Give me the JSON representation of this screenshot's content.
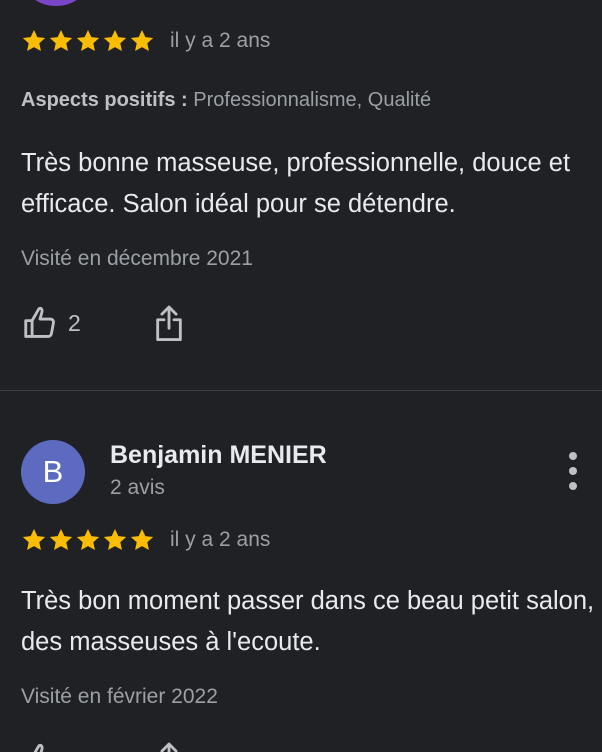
{
  "colors": {
    "background": "#202124",
    "star": "#fbbc04",
    "avatar_top": "#7b45c8",
    "avatar": "#5c6bc0"
  },
  "reviews": [
    {
      "rating": 5,
      "time_ago": "il y a 2 ans",
      "aspects_label": "Aspects positifs :",
      "aspects_value": "Professionnalisme, Qualité",
      "text": "Très bonne masseuse, professionnelle, douce et efficace. Salon idéal pour se détendre.",
      "visited": "Visité en décembre 2021",
      "like_count": "2",
      "icons": {
        "like": "thumbs-up-icon",
        "share": "share-icon"
      }
    },
    {
      "author": {
        "initial": "B",
        "name": "Benjamin MENIER",
        "review_count": "2 avis"
      },
      "rating": 5,
      "time_ago": "il y a 2 ans",
      "text": "Très bon moment passer dans ce beau petit salon, des masseuses à l'ecoute.",
      "visited": "Visité en février 2022",
      "icons": {
        "more": "more-vert-icon"
      }
    }
  ]
}
